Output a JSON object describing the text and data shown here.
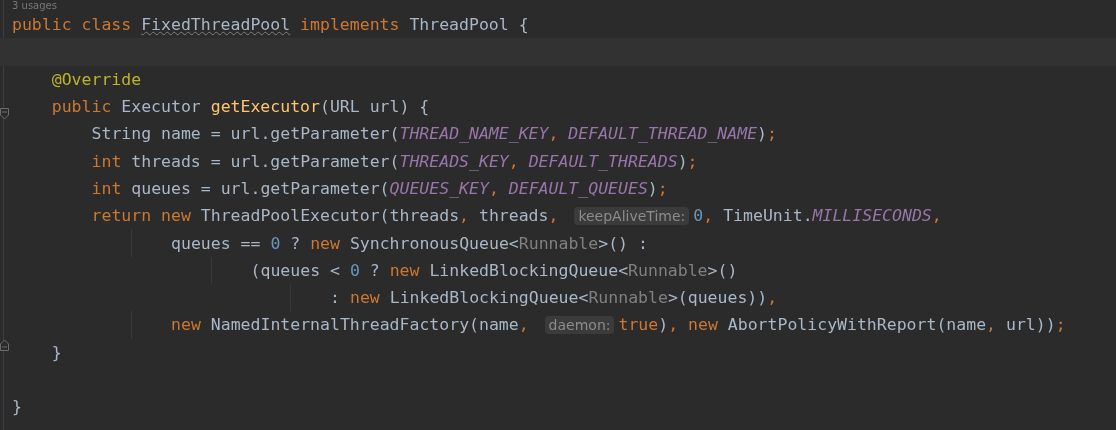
{
  "usages": "3 usages",
  "lines": [
    {
      "current": false,
      "wrapped": false,
      "fold_start": false,
      "fold_end": false,
      "tokens": [
        {
          "kind": "kw",
          "t": "public class "
        },
        {
          "kind": "warn",
          "t": "FixedThreadPool"
        },
        {
          "kind": "kw",
          "t": " implements "
        },
        {
          "kind": "plain",
          "t": "ThreadPool {"
        }
      ],
      "children": [
        {
          "current": true,
          "fold_start": false,
          "fold_end": false
        },
        {
          "current": false,
          "wrapped": false,
          "fold_start": false,
          "fold_end": false,
          "tokens": [
            {
              "kind": "ann",
              "t": "@Override"
            }
          ]
        },
        {
          "current": false,
          "wrapped": false,
          "fold_start": true,
          "fold_end": false,
          "tokens": [
            {
              "kind": "kw",
              "t": "public "
            },
            {
              "kind": "plain",
              "t": "Executor "
            },
            {
              "kind": "fn",
              "t": "getExecutor"
            },
            {
              "kind": "plain",
              "t": "(URL url) {"
            }
          ],
          "children": [
            {
              "current": false,
              "wrapped": false,
              "fold_start": false,
              "fold_end": false,
              "tokens": [
                {
                  "kind": "plain",
                  "t": "String name = url.getParameter("
                },
                {
                  "kind": "const",
                  "t": "THREAD_NAME_KEY"
                },
                {
                  "kind": "punct",
                  "t": ", "
                },
                {
                  "kind": "const",
                  "t": "DEFAULT_THREAD_NAME"
                },
                {
                  "kind": "plain",
                  "t": ")"
                },
                {
                  "kind": "punct",
                  "t": ";"
                }
              ]
            },
            {
              "current": false,
              "wrapped": false,
              "fold_start": false,
              "fold_end": false,
              "tokens": [
                {
                  "kind": "kw",
                  "t": "int "
                },
                {
                  "kind": "plain",
                  "t": "threads = url.getParameter("
                },
                {
                  "kind": "const",
                  "t": "THREADS_KEY"
                },
                {
                  "kind": "punct",
                  "t": ", "
                },
                {
                  "kind": "const",
                  "t": "DEFAULT_THREADS"
                },
                {
                  "kind": "plain",
                  "t": ")"
                },
                {
                  "kind": "punct",
                  "t": ";"
                }
              ]
            },
            {
              "current": false,
              "wrapped": false,
              "fold_start": false,
              "fold_end": false,
              "tokens": [
                {
                  "kind": "kw",
                  "t": "int "
                },
                {
                  "kind": "plain",
                  "t": "queues = url.getParameter("
                },
                {
                  "kind": "const",
                  "t": "QUEUES_KEY"
                },
                {
                  "kind": "punct",
                  "t": ", "
                },
                {
                  "kind": "const",
                  "t": "DEFAULT_QUEUES"
                },
                {
                  "kind": "plain",
                  "t": ")"
                },
                {
                  "kind": "punct",
                  "t": ";"
                }
              ]
            },
            {
              "current": false,
              "wrapped": false,
              "fold_start": false,
              "fold_end": false,
              "tokens": [
                {
                  "kind": "kw",
                  "t": "return new "
                },
                {
                  "kind": "plain",
                  "t": "ThreadPoolExecutor(threads"
                },
                {
                  "kind": "punct",
                  "t": ", "
                },
                {
                  "kind": "plain",
                  "t": "threads"
                },
                {
                  "kind": "punct",
                  "t": ", "
                },
                {
                  "kind": "hint",
                  "t": "keepAliveTime:"
                },
                {
                  "kind": "num",
                  "t": "0"
                },
                {
                  "kind": "punct",
                  "t": ", "
                },
                {
                  "kind": "plain",
                  "t": "TimeUnit."
                },
                {
                  "kind": "const",
                  "t": "MILLISECONDS"
                },
                {
                  "kind": "punct",
                  "t": ","
                }
              ],
              "children": [
                {
                  "current": false,
                  "wrapped": true,
                  "fold_start": false,
                  "fold_end": false,
                  "tokens": [
                    {
                      "kind": "plain",
                      "t": "queues == "
                    },
                    {
                      "kind": "num",
                      "t": "0"
                    },
                    {
                      "kind": "plain",
                      "t": " ? "
                    },
                    {
                      "kind": "kw",
                      "t": "new "
                    },
                    {
                      "kind": "plain",
                      "t": "SynchronousQueue<"
                    },
                    {
                      "kind": "gen",
                      "t": "Runnable"
                    },
                    {
                      "kind": "plain",
                      "t": ">() :"
                    }
                  ],
                  "children": [
                    {
                      "current": false,
                      "wrapped": true,
                      "fold_start": false,
                      "fold_end": false,
                      "tokens": [
                        {
                          "kind": "plain",
                          "t": "(queues < "
                        },
                        {
                          "kind": "num",
                          "t": "0"
                        },
                        {
                          "kind": "plain",
                          "t": " ? "
                        },
                        {
                          "kind": "kw",
                          "t": "new "
                        },
                        {
                          "kind": "plain",
                          "t": "LinkedBlockingQueue<"
                        },
                        {
                          "kind": "gen",
                          "t": "Runnable"
                        },
                        {
                          "kind": "plain",
                          "t": ">()"
                        }
                      ],
                      "children": [
                        {
                          "current": false,
                          "wrapped": true,
                          "fold_start": false,
                          "fold_end": false,
                          "tokens": [
                            {
                              "kind": "plain",
                              "t": ": "
                            },
                            {
                              "kind": "kw",
                              "t": "new "
                            },
                            {
                              "kind": "plain",
                              "t": "LinkedBlockingQueue<"
                            },
                            {
                              "kind": "gen",
                              "t": "Runnable"
                            },
                            {
                              "kind": "plain",
                              "t": ">(queues))"
                            },
                            {
                              "kind": "punct",
                              "t": ","
                            }
                          ]
                        }
                      ]
                    }
                  ]
                },
                {
                  "current": false,
                  "wrapped": true,
                  "fold_start": false,
                  "fold_end": false,
                  "tokens": [
                    {
                      "kind": "kw",
                      "t": "new "
                    },
                    {
                      "kind": "plain",
                      "t": "NamedInternalThreadFactory(name"
                    },
                    {
                      "kind": "punct",
                      "t": ", "
                    },
                    {
                      "kind": "hint",
                      "t": "daemon:"
                    },
                    {
                      "kind": "kw",
                      "t": "true"
                    },
                    {
                      "kind": "plain",
                      "t": ")"
                    },
                    {
                      "kind": "punct",
                      "t": ", "
                    },
                    {
                      "kind": "kw",
                      "t": "new "
                    },
                    {
                      "kind": "plain",
                      "t": "AbortPolicyWithReport(name"
                    },
                    {
                      "kind": "punct",
                      "t": ", "
                    },
                    {
                      "kind": "plain",
                      "t": "url))"
                    },
                    {
                      "kind": "punct",
                      "t": ";"
                    }
                  ]
                }
              ]
            }
          ]
        },
        {
          "current": false,
          "wrapped": false,
          "fold_start": false,
          "fold_end": true,
          "tokens": [
            {
              "kind": "plain",
              "t": "}"
            }
          ]
        }
      ]
    },
    {
      "current": false,
      "fold_start": false,
      "fold_end": false
    },
    {
      "current": false,
      "wrapped": false,
      "fold_start": false,
      "fold_end": false,
      "tokens": [
        {
          "kind": "plain",
          "t": "}"
        }
      ]
    }
  ]
}
